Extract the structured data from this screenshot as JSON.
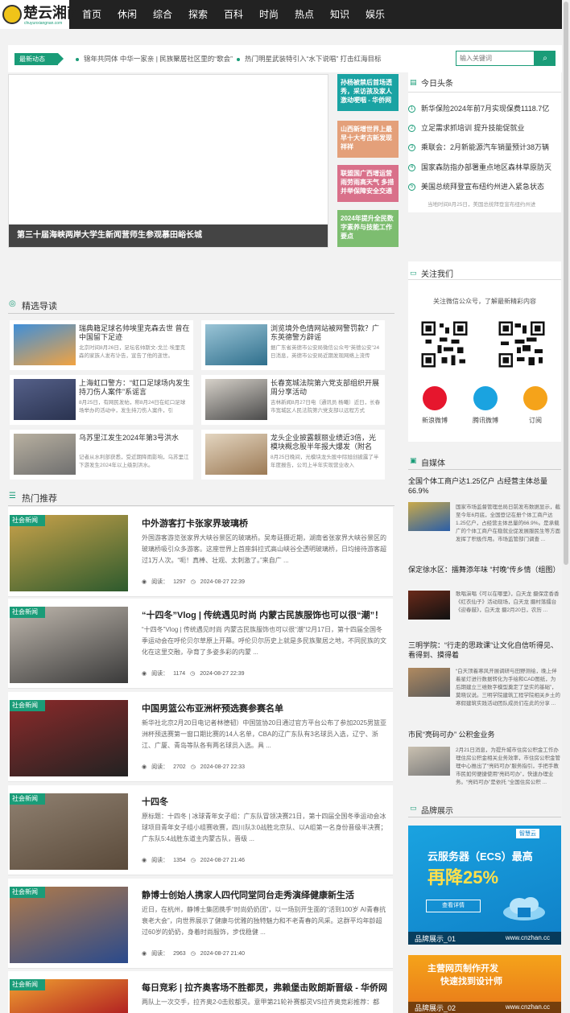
{
  "nav": {
    "logo_text": "楚云湘南",
    "logo_sub": "chuyunxiangnan.com",
    "items": [
      "首页",
      "休闲",
      "综合",
      "探索",
      "百科",
      "时尚",
      "热点",
      "知识",
      "娱乐"
    ]
  },
  "ticker": {
    "tag": "最新动态",
    "items": [
      "锦年共同体 中华一家亲 | 民族聚居社区里的“歌会”",
      "热门明星武装特引入“水下说唱” 打击红海目标"
    ],
    "search_placeholder": "输入关键词",
    "search_icon": "search-icon"
  },
  "slider": {
    "caption": "第三十届海峡两岸大学生新闻营师生参观慕田峪长城"
  },
  "side_tiles": [
    {
      "text": "孙杨被禁后首场透秀，采访孩及家人激动哽咽 - 华侨网",
      "color": "#1aa3a3"
    },
    {
      "text": "山西新增世界上最早十大考古新发现  祥祥",
      "color": "#e4a07a"
    },
    {
      "text": "联盟国广西增运营雨劳雨高天气 多措并举保障安全交通",
      "color": "#d9708a"
    },
    {
      "text": "2024年提升全民数字素养与技能工作要点",
      "color": "#7dbd70"
    }
  ],
  "headlines": {
    "title": "今日头条",
    "items": [
      "新华保险2024年前7月实现保费1118.7亿",
      "立足需求抓培训 提升技能促就业",
      "乘联会：2月新能源汽车销量预计38万辆",
      "国家森防指办部署重点地区森林草原防灭",
      "美国总统拜登宣布纽约州进入紧急状态"
    ],
    "footnote": "当地时间8月25日，美国总统拜登宣布纽约州进"
  },
  "guide": {
    "title": "精选导读",
    "cards": [
      {
        "title": "瑞典籍足球名帅埃里克森去世 曾在中国留下足迹",
        "desc": "北京时间8月26日，足坛名帅斯文-戈兰·埃里克森的家族人发布讣告，宣告了他的逝世。",
        "colors": [
          "#f2a341",
          "#3f8fd9"
        ]
      },
      {
        "title": "浏览境外色情网站被网警罚款？广东英德警方辟谣",
        "desc": "据广东省英德市公安局微信公众号“英德公安”24日消息，英德市公安局近期发现网络上流传",
        "colors": [
          "#2f6f8c",
          "#9ac4d6"
        ]
      },
      {
        "title": "上海虹口警方：“虹口足球场内发生持刀伤人案件”系谣言",
        "desc": "8月25日，有网民发帖，称8月24日在虹口足球场举办的活动中，发生持刀伤人案件，引",
        "colors": [
          "#2a3350",
          "#556089"
        ]
      },
      {
        "title": "长春宽城法院第六党支部组织开展周分享活动",
        "desc": "吉林新闻8月27日电（通讯员 杨曦）近日，长春市宽城区人民法院第六党支部以远程方式",
        "colors": [
          "#4a4a4a",
          "#d6d1c9"
        ]
      },
      {
        "title": "乌苏里江发生2024年第3号洪水",
        "desc": "记者从水利部获悉，受近期降雨影响，乌苏里江下游发生2024年以上级别洪水。",
        "colors": [
          "#6f6f6f",
          "#b8b0a0"
        ]
      },
      {
        "title": "龙头企业披露靓丽业绩近3倍，光模块概念股半年报大爆发（附名单）",
        "desc": "8月25日晚间，光模块龙头股中际旭创披露了半年度报告，公司上半年实现营业收入",
        "colors": [
          "#9c7a55",
          "#e3d5c0"
        ]
      }
    ]
  },
  "hot": {
    "title": "热门推荐",
    "tag": "社会新闻",
    "read_label": "阅读：",
    "items": [
      {
        "title": "中外游客打卡张家界玻璃桥",
        "summary": "外国游客游览张家界大峡谷景区的玻璃桥。吴寿廷摄近期，湖南省张家界大峡谷景区的玻璃桥吸引众多游客。这座世界上首座斜拉式高山峡谷全透明玻璃桥，日均接待游客超过1万人次。“呃！真棒、壮观、太刺激了。”来自广 ...",
        "reads": "1297",
        "date": "2024-08-27 22:39",
        "colors": [
          "#2d5a2d",
          "#c9a24a"
        ]
      },
      {
        "title": "“十四冬”Vlog | 传统遇见时尚 内蒙古民族服饰也可以很“潮”！",
        "summary": "“十四冬”Vlog | 传统遇见时尚 内蒙古民族服饰也可以很“潮”!2月17日，第十四届全国冬季运动会在呼伦贝尔草原上开幕。呼伦贝尔历史上就是多民族聚居之地，不同民族的文化在这里交融，孕育了多姿多彩的内蒙 ...",
        "reads": "1174",
        "date": "2024-08-27 22:39",
        "colors": [
          "#3a3a3a",
          "#bfb7ad"
        ]
      },
      {
        "title": "中国男篮公布亚洲杯预选赛参赛名单",
        "summary": "新华社北京2月20日电记者林德韧）中国篮协20日通过官方平台公布了参加2025男篮亚洲杯预选赛第一窗口期比赛的14人名单，CBA的辽广东队有3名球员入选，辽宁、浙江、广厦、青岛等队各有两名球员入选。具 ...",
        "reads": "2702",
        "date": "2024-08-27 22:33",
        "colors": [
          "#222",
          "#8c2a2a"
        ]
      },
      {
        "title": "十四冬",
        "summary": "原标题：十四冬 | 冰球青年女子组：广东队冒领决赛21日，第十四届全国冬季运动会冰球项目青年女子组小组赛收赛，四川队3:0战胜北京队、以A组第一名身份晋级半决赛；广东队5:4战胜东道主内蒙古队，晋级 ...",
        "reads": "1354",
        "date": "2024-08-27 21:46",
        "colors": [
          "#5a4a3a",
          "#8f8070"
        ]
      },
      {
        "title": "静博士创始人携家人四代同堂同台走秀演绎健康新生活",
        "summary": "近日，在杭州，静博士集团携手“时尚奶奶团”，以一场别开生面的“活到100岁 AI青春抗衰老大会”，向世界展示了健康与优雅的独特魅力和不老青春的风采。这群平均年龄超过60岁的奶奶，身着时尚服饰，步伐稳健 ...",
        "reads": "2963",
        "date": "2024-08-27 21:40",
        "colors": [
          "#2a4a8c",
          "#b07a4a"
        ]
      },
      {
        "title": "每日竞彩 | 拉齐奥客场不胜都灵，弗赖堡击败朗斯晋级 - 华侨网",
        "summary": "两队上一次交手，拉齐奥2-0击败都灵。意甲第21轮补赛都灵VS拉齐奥竞彩推荐：都",
        "reads": "",
        "date": "",
        "colors": [
          "#b22222",
          "#f0a030"
        ]
      }
    ]
  },
  "follow": {
    "title": "关注我们",
    "desc": "关注微信公众号，了解最新精彩内容",
    "socials": [
      {
        "label": "新浪微博",
        "color": "#e6162d",
        "icon": "weibo-icon"
      },
      {
        "label": "腾讯微博",
        "color": "#1aa3e0",
        "icon": "tencent-weibo-icon"
      },
      {
        "label": "订阅",
        "color": "#f5a31a",
        "icon": "rss-icon"
      }
    ]
  },
  "media": {
    "title": "自媒体",
    "items": [
      {
        "title": "全国个体工商户达1.25亿户 占经营主体总量66.9%",
        "desc": "国家市场监督管理总局日前发布数据显示，截至今年6月底，全国登记在册个体工商户达1.25亿户，占经营主体总量的66.9%。是承载广的个体工商户在稳就业促发展服民生等方面发挥了积极作用。市场监管部门调查 ..."
      },
      {
        "title": "保定徐水区：擂舞添年味 “村晚”传乡情（组图）",
        "desc": "歌唱演唱《可以在哪里》，白天龙 摄保定香香《红衣仙子》活动现场，白天龙 摄村落擂台《迎春鼓》，白天龙 摄2月20日，农历 ..."
      },
      {
        "title": "三明学院：“行走的思政课”让文化自信听得见、看得到、摸得着",
        "desc": "“白天顶着寒风开展调研与田野测绘，晚上伴着星灯进行数据转化为手绘和CAD图纸，为后期建立三维数字模型奠定了坚实的基础”，莫晓议说。三明学院建筑工程学院相关乡土的寒假建筑实践活动团队成员们在此的分享 ..."
      },
      {
        "title": "市民“亮码可办” 公积金业务",
        "desc": "2月21日消息，为提升城市住房公积金工作办理住房公积金相关业务效率，市住房公积金管理中心推出了“亮码可办”服务指引，手把手教市民如何便捷使用“亮码可办”，快速办理业务。“亮码可办”是依托 “全国住房公积 ..."
      }
    ]
  },
  "brand": {
    "title": "品牌展示",
    "cards": [
      {
        "caption": "品牌展示_01",
        "url": "www.cnzhan.cc",
        "logo": "智慧云",
        "line1": "云服务器（ECS）最高",
        "line2": "再降25%",
        "btn": "查看详情"
      },
      {
        "caption": "品牌展示_02",
        "url": "www.cnzhan.cc",
        "line1": "主营网页制作开发",
        "line2": "快速找到设计师"
      }
    ]
  }
}
